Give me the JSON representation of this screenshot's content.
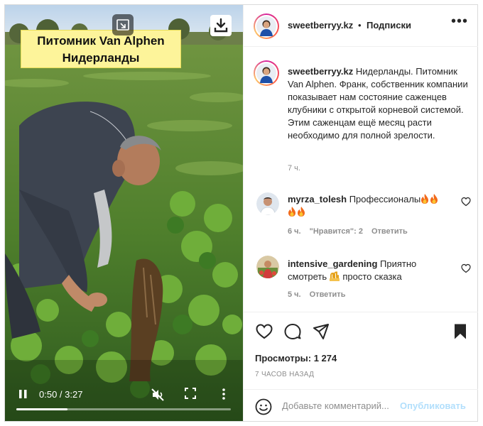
{
  "video": {
    "caption_line1": "Питомник Van Alphen",
    "caption_line2": "Нидерланды",
    "time": "0:50 / 3:27",
    "progress": 0.24
  },
  "post": {
    "username": "sweetberryy.kz",
    "separator": "•",
    "follow_label": "Подписки",
    "more_label": "•••",
    "caption_text": " Нидерланды. Питомник Van Alphen. Франк, собственник компании показывает нам состояние саженцев клубники с открытой корневой системой. Этим саженцам ещё месяц расти необходимо для полной зрелости.",
    "caption_time": "7 ч."
  },
  "comments": [
    {
      "username": "myrza_tolesh",
      "text": " Профессионалы",
      "time": "6 ч.",
      "likes": "\"Нравится\": 2",
      "reply": "Ответить"
    },
    {
      "username": "intensive_gardening",
      "text": " Приятно смотреть",
      "text2": " просто сказка",
      "time": "5 ч.",
      "reply": "Ответить"
    }
  ],
  "footer": {
    "views": "Просмотры: 1 274",
    "ago": "7 ЧАСОВ НАЗАД",
    "comment_placeholder": "Добавьте комментарий...",
    "publish_label": "Опубликовать"
  },
  "icons": {
    "pip": "picture-in-picture-icon",
    "download": "download-icon",
    "play": "pause-icon",
    "mute": "volume-muted-icon",
    "fullscreen": "fullscreen-icon",
    "more_vertical": "more-vertical-icon",
    "heart": "heart-icon",
    "comment": "comment-icon",
    "share": "share-icon",
    "bookmark": "bookmark-icon",
    "emoji": "smiley-icon"
  },
  "colors": {
    "accent": "#0095f6",
    "publish_disabled": "#b2dffc",
    "caption_bg": "#fdf49a"
  }
}
